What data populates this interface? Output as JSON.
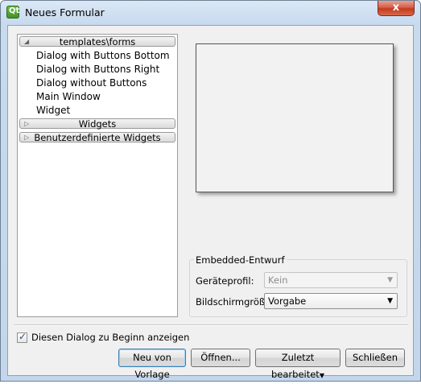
{
  "window": {
    "title": "Neues Formular",
    "app_icon_glyph": "Qt",
    "close_glyph": "x"
  },
  "tree": {
    "categories": [
      {
        "label": "templates\\forms",
        "expanded": true,
        "items": [
          "Dialog with Buttons Bottom",
          "Dialog with Buttons Right",
          "Dialog without Buttons",
          "Main Window",
          "Widget"
        ]
      },
      {
        "label": "Widgets",
        "expanded": false
      },
      {
        "label": "Benutzerdefinierte Widgets",
        "expanded": false
      }
    ]
  },
  "embedded": {
    "group_title": "Embedded-Entwurf",
    "device_label": "Geräteprofil:",
    "device_value": "Kein",
    "screen_label": "Bildschirmgröße:",
    "screen_value": "Vorgabe"
  },
  "show_on_start": {
    "label": "Diesen Dialog zu Beginn anzeigen",
    "checked": true
  },
  "buttons": {
    "new_from_template": "Neu von Vorlage",
    "open": "Öffnen...",
    "recent": "Zuletzt bearbeitet",
    "close": "Schließen"
  },
  "colors": {
    "title_bar": "#c8daee",
    "close_button": "#c5391d",
    "default_button_border": "#3c7fb1"
  }
}
